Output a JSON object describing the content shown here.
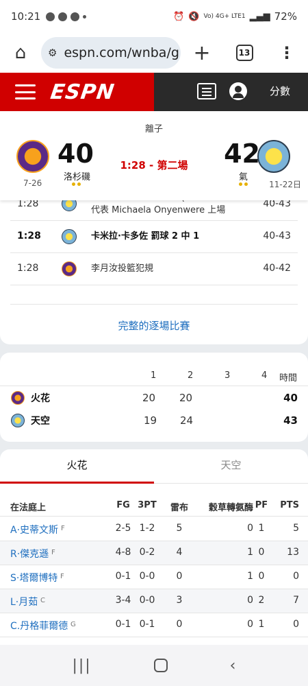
{
  "status_bar": {
    "time": "10:21",
    "network": "Vo) 4G+ LTE1",
    "battery": "72%"
  },
  "browser": {
    "url": "espn.com/wnba/g",
    "tab_count": "13"
  },
  "espn_header": {
    "logo": "ESPN",
    "score_link": "分數"
  },
  "scoreboard": {
    "status": "離子",
    "clock": "1:28 - 第二場",
    "home": {
      "name": "洛杉磯",
      "score": "40",
      "record": "7-26"
    },
    "away": {
      "name": "氣",
      "score": "42",
      "record": "11-22日"
    }
  },
  "play_by_play": {
    "rows": [
      {
        "time": "1:28",
        "desc": "Diamond DeShields (Diamond DeShields)\n代表 Michaela Onyenwere 上場",
        "score": "40-43",
        "team": "sky",
        "bold": false
      },
      {
        "time": "1:28",
        "desc": "卡米拉·卡多佐 罰球 2 中 1",
        "score": "40-43",
        "team": "sky",
        "bold": true
      },
      {
        "time": "1:28",
        "desc": "李月汝投籃犯規",
        "score": "40-42",
        "team": "sparks",
        "bold": false
      }
    ],
    "full_link": "完整的逐場比賽"
  },
  "linescore": {
    "headers": [
      "1",
      "2",
      "3",
      "4",
      "時間"
    ],
    "rows": [
      {
        "team": "火花",
        "q": [
          "20",
          "20",
          "",
          ""
        ],
        "total": "40"
      },
      {
        "team": "天空",
        "q": [
          "19",
          "24",
          "",
          ""
        ],
        "total": "43"
      }
    ]
  },
  "boxscore": {
    "tabs": [
      "火花",
      "天空"
    ],
    "section": "在法庭上",
    "columns": [
      "FG",
      "3PT",
      "雷布",
      "穀草轉氨酶",
      "PF",
      "PTS"
    ],
    "players": [
      {
        "name": "A·史蒂文斯",
        "pos": "F",
        "fg": "2-5",
        "tpt": "1-2",
        "reb": "5",
        "ast": "0",
        "pf": "1",
        "pts": "5"
      },
      {
        "name": "R·傑克遜",
        "pos": "F",
        "fg": "4-8",
        "tpt": "0-2",
        "reb": "4",
        "ast": "1",
        "pf": "0",
        "pts": "13"
      },
      {
        "name": "S·塔爾博特",
        "pos": "F",
        "fg": "0-1",
        "tpt": "0-0",
        "reb": "0",
        "ast": "1",
        "pf": "0",
        "pts": "0"
      },
      {
        "name": "L·月茹",
        "pos": "C",
        "fg": "3-4",
        "tpt": "0-0",
        "reb": "3",
        "ast": "0",
        "pf": "2",
        "pts": "7"
      },
      {
        "name": "C.丹格菲爾德",
        "pos": "G",
        "fg": "0-1",
        "tpt": "0-1",
        "reb": "0",
        "ast": "0",
        "pf": "1",
        "pts": "0"
      }
    ]
  },
  "colors": {
    "espn_red": "#d00000",
    "link_blue": "#1f6fbf",
    "clock_red": "#d00000"
  }
}
